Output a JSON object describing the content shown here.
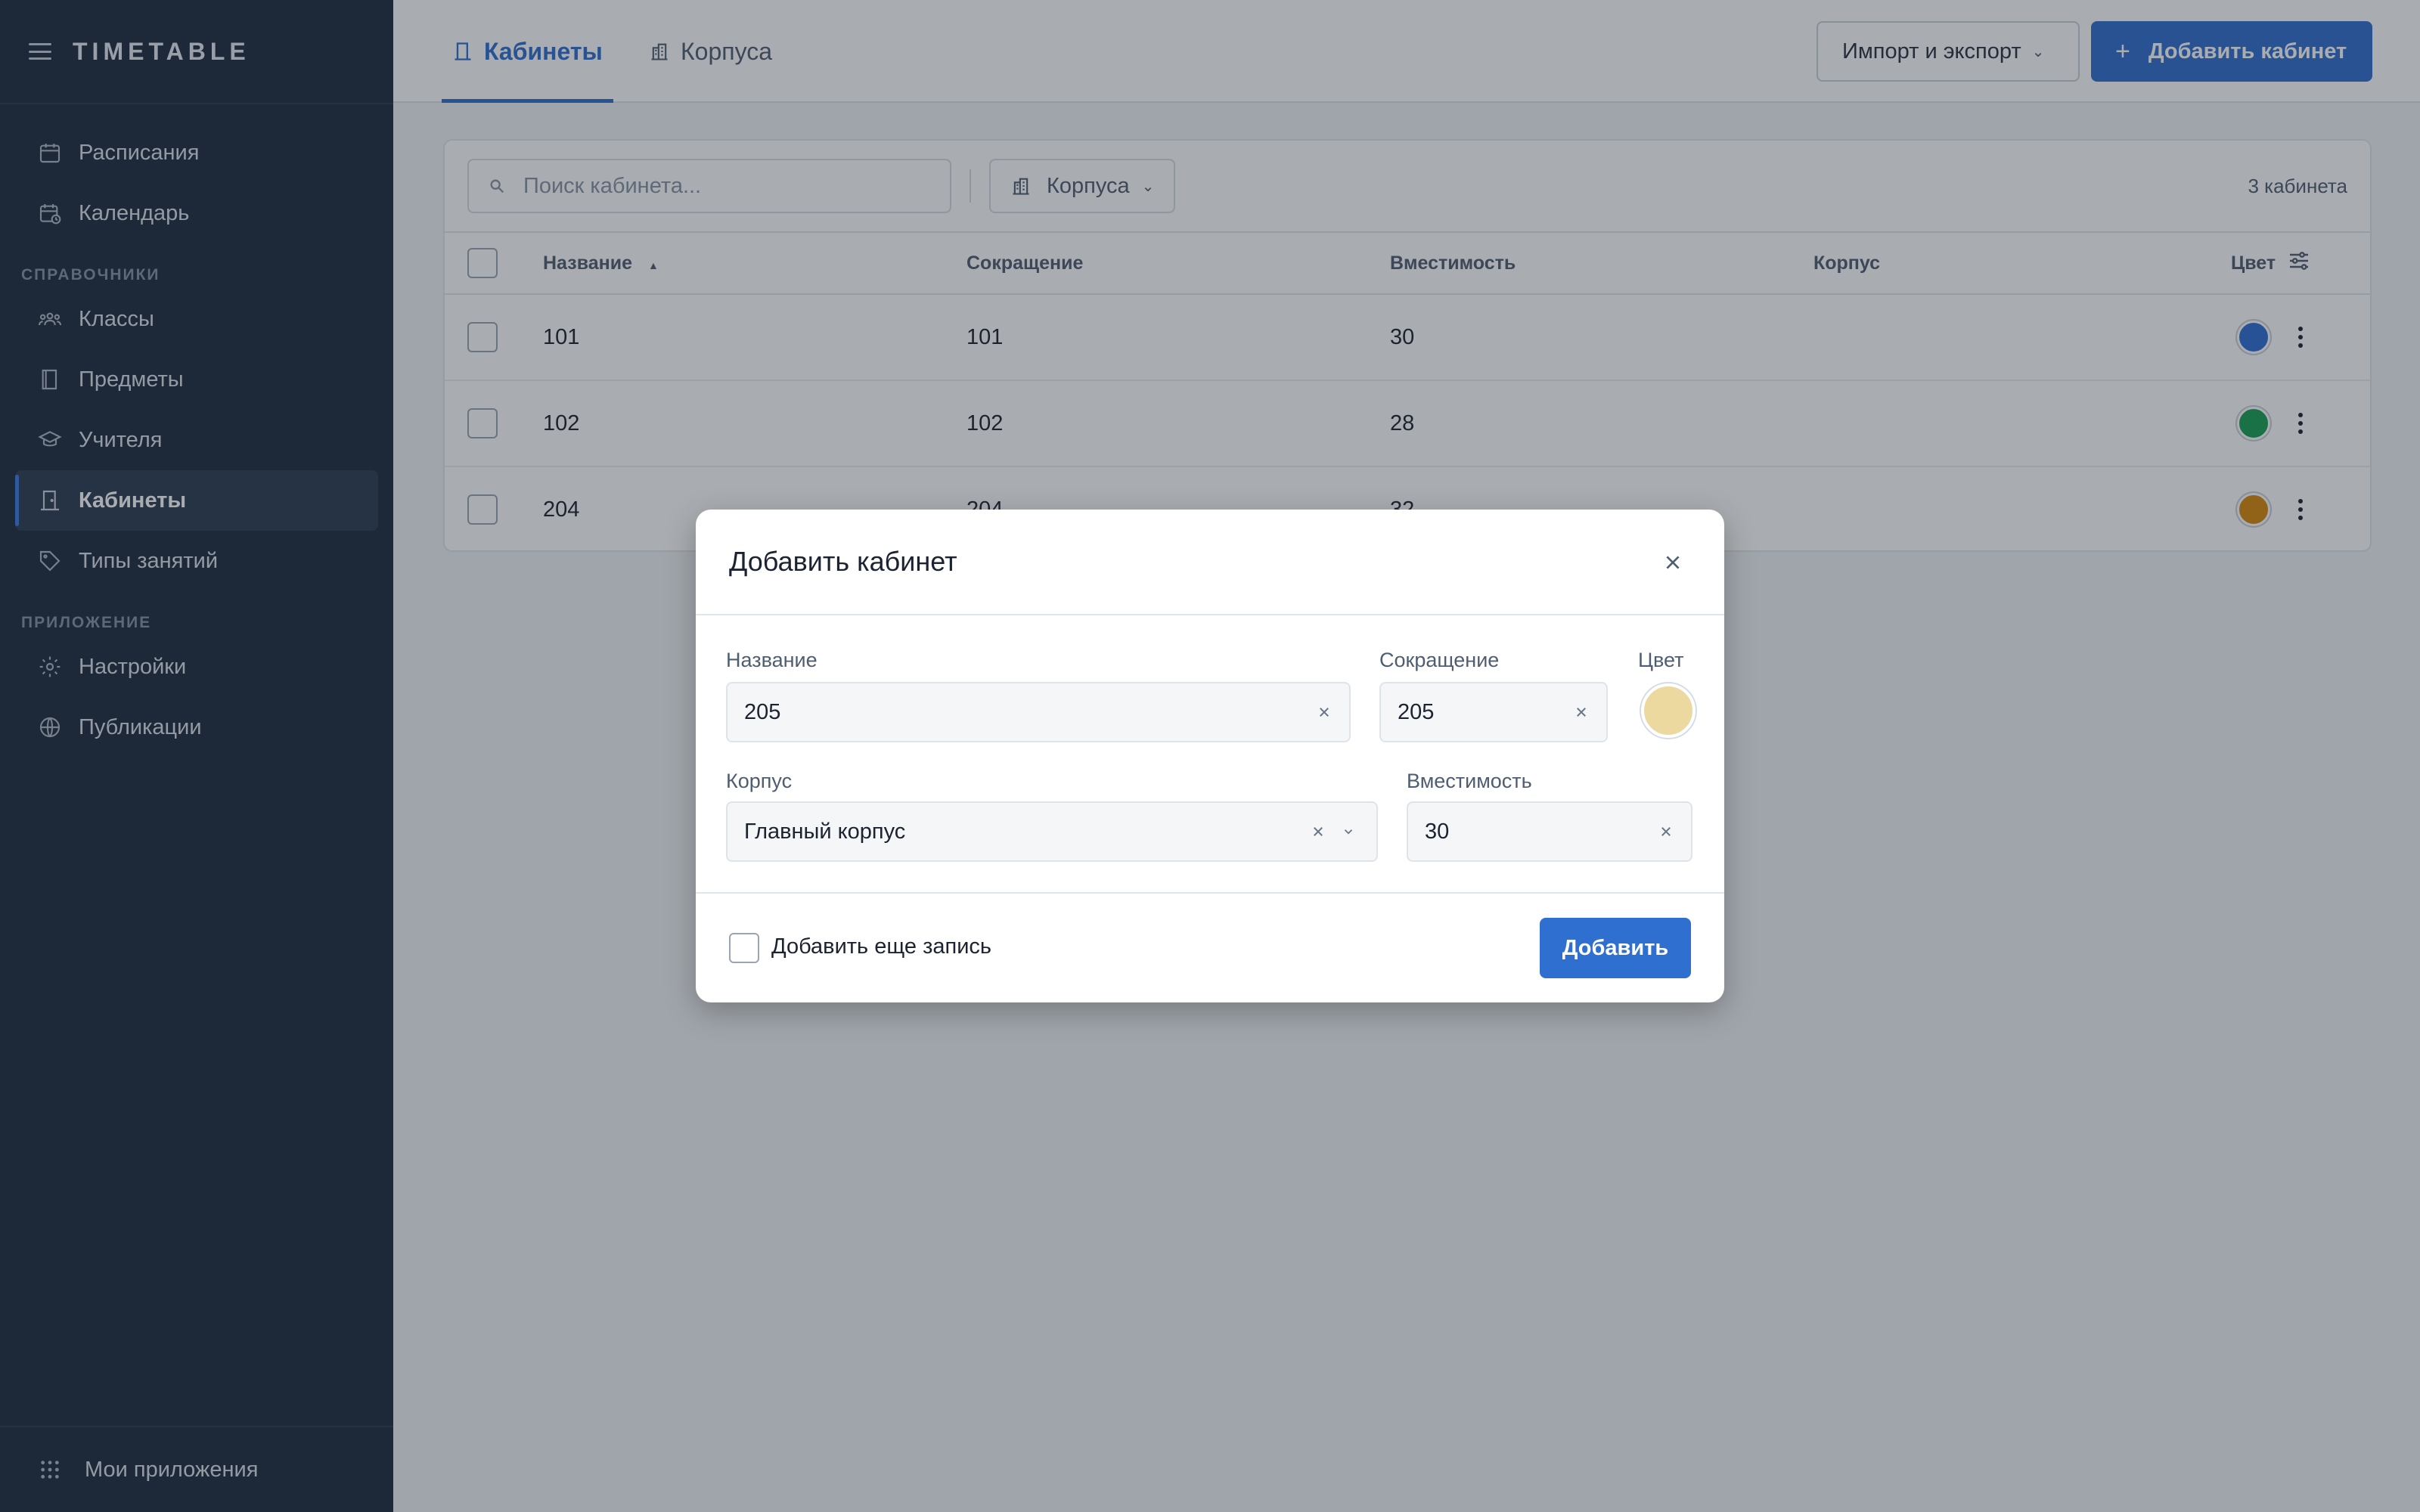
{
  "sidebar": {
    "logo": "TIMETABLE",
    "items_top": [
      {
        "label": "Расписания",
        "icon": "calendar-icon"
      },
      {
        "label": "Календарь",
        "icon": "calendar-clock-icon"
      }
    ],
    "section_refs": "СПРАВОЧНИКИ",
    "items_refs": [
      {
        "label": "Классы",
        "icon": "group-icon"
      },
      {
        "label": "Предметы",
        "icon": "book-icon"
      },
      {
        "label": "Учителя",
        "icon": "graduation-cap-icon"
      },
      {
        "label": "Кабинеты",
        "icon": "door-icon",
        "active": true
      },
      {
        "label": "Типы занятий",
        "icon": "tag-icon"
      }
    ],
    "section_app": "ПРИЛОЖЕНИЕ",
    "items_app": [
      {
        "label": "Настройки",
        "icon": "gear-icon"
      },
      {
        "label": "Публикации",
        "icon": "globe-icon"
      }
    ],
    "footer_label": "Мои приложения"
  },
  "topbar": {
    "tabs": [
      {
        "label": "Кабинеты",
        "active": true
      },
      {
        "label": "Корпуса",
        "active": false
      }
    ],
    "import_export": "Импорт и экспорт",
    "add_room": "Добавить кабинет"
  },
  "filters": {
    "search_placeholder": "Поиск кабинета...",
    "buildings_filter": "Корпуса",
    "count": "3 кабинета"
  },
  "table": {
    "headers": {
      "name": "Название",
      "short": "Сокращение",
      "capacity": "Вместимость",
      "building": "Корпус",
      "color": "Цвет"
    },
    "rows": [
      {
        "name": "101",
        "short": "101",
        "capacity": "30",
        "building": "",
        "color": "#2f6fd6"
      },
      {
        "name": "102",
        "short": "102",
        "capacity": "28",
        "building": "",
        "color": "#1aa155"
      },
      {
        "name": "204",
        "short": "204",
        "capacity": "32",
        "building": "",
        "color": "#d88a0a"
      }
    ]
  },
  "modal": {
    "title": "Добавить кабинет",
    "name_label": "Название",
    "name_value": "205",
    "short_label": "Сокращение",
    "short_value": "205",
    "color_label": "Цвет",
    "color_value": "#ecd9a0",
    "building_label": "Корпус",
    "building_value": "Главный корпус",
    "capacity_label": "Вместимость",
    "capacity_value": "30",
    "add_another": "Добавить еще запись",
    "submit": "Добавить"
  },
  "colors": {
    "accent": "#2f6fcf",
    "sidebar_bg": "#1e2c3e"
  }
}
